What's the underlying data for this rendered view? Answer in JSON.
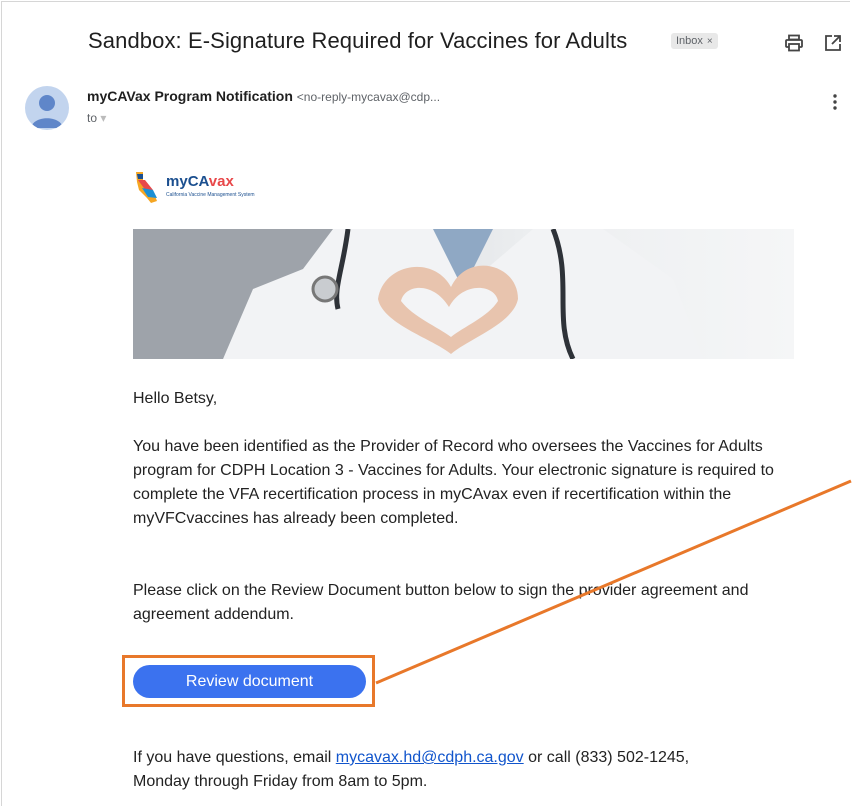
{
  "email": {
    "subject": "Sandbox: E-Signature Required for Vaccines for Adults",
    "label_chip": "Inbox",
    "label_chip_close": "×",
    "sender_name": "myCAVax Program Notification",
    "sender_email": "<no-reply-mycavax@cdp...",
    "to_label": "to"
  },
  "logo": {
    "brand_prefix": "my",
    "brand_ca": "CA",
    "brand_suffix": "vax",
    "tagline": "California Vaccine Management System"
  },
  "body": {
    "greeting": "Hello Betsy,",
    "paragraph1": "You have been identified as the Provider of Record who oversees the Vaccines for Adults program for CDPH Location 3 - Vaccines for Adults. Your electronic signature is required to complete the VFA recertification process in myCAvax even if recertification within the myVFCvaccines has already been completed.",
    "paragraph2": "Please click on the Review Document button below to sign the provider agreement and agreement addendum.",
    "cta_label": "Review document",
    "contact_prefix": "If you have questions, email ",
    "contact_email": "mycavax.hd@cdph.ca.gov",
    "contact_suffix": " or call (833) 502-1245,",
    "contact_line2": "Monday through Friday from 8am to 5pm."
  },
  "colors": {
    "cta": "#3b72ef",
    "highlight": "#e8782a",
    "link": "#1155cc"
  },
  "icons": [
    "print-icon",
    "open-in-new-window-icon",
    "more-vert-icon",
    "avatar-icon"
  ]
}
